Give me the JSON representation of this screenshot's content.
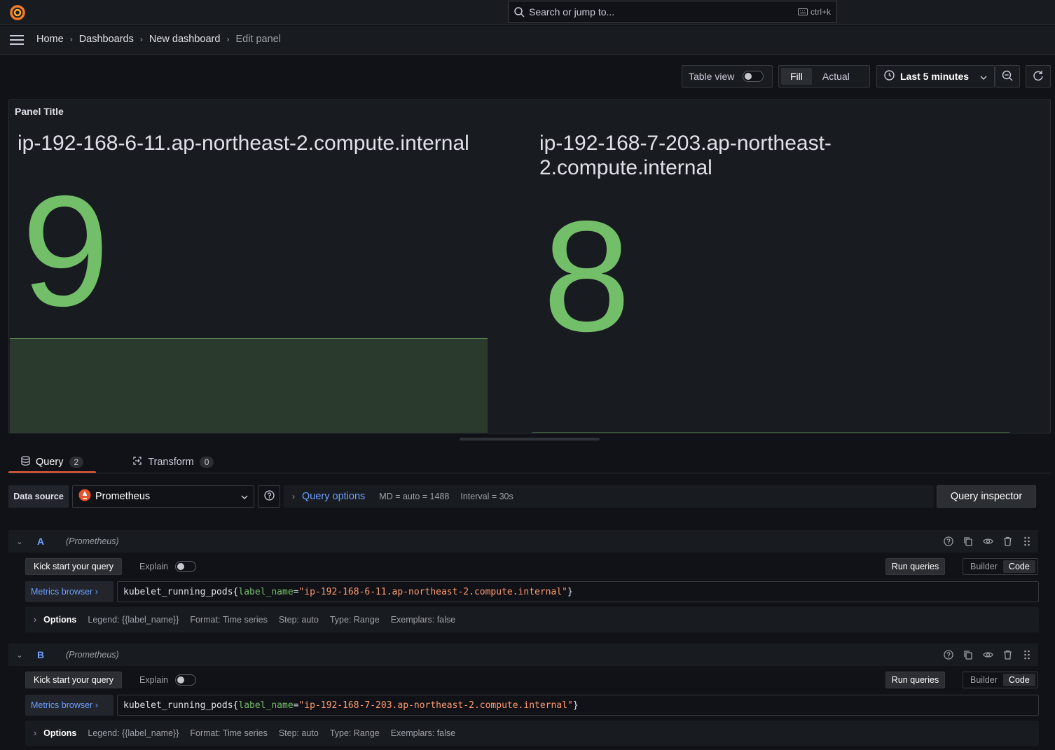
{
  "topbar": {
    "search_placeholder": "Search or jump to...",
    "shortcut": "ctrl+k"
  },
  "breadcrumb": [
    "Home",
    "Dashboards",
    "New dashboard",
    "Edit panel"
  ],
  "toolbar": {
    "table_view": "Table view",
    "fill": "Fill",
    "actual": "Actual",
    "time_range": "Last 5 minutes"
  },
  "panel": {
    "title": "Panel Title",
    "stats": [
      {
        "name": "ip-192-168-6-11.ap-northeast-2.compute.internal",
        "value": "9"
      },
      {
        "name_line1": "ip-192-168-7-203.ap-northeast-",
        "name_line2": "2.compute.internal",
        "value": "8"
      }
    ],
    "value_color": "#73bf69"
  },
  "tabs": [
    {
      "label": "Query",
      "count": "2"
    },
    {
      "label": "Transform",
      "count": "0"
    }
  ],
  "datasource": {
    "label": "Data source",
    "selected": "Prometheus",
    "query_options": "Query options",
    "md": "MD = auto = 1488",
    "interval": "Interval = 30s",
    "inspector": "Query inspector"
  },
  "queries": [
    {
      "ref": "A",
      "ds": "(Prometheus)",
      "kick": "Kick start your query",
      "explain": "Explain",
      "run": "Run queries",
      "builder": "Builder",
      "code": "Code",
      "metrics_browser": "Metrics browser",
      "q_metric": "kubelet_running_pods{",
      "q_label": "label_name",
      "q_eq": "=",
      "q_value": "\"ip-192-168-6-11.ap-northeast-2.compute.internal\"",
      "q_close": "}",
      "options": "Options",
      "legend": "Legend: {{label_name}}",
      "format": "Format: Time series",
      "step": "Step: auto",
      "type": "Type: Range",
      "exemplars": "Exemplars: false"
    },
    {
      "ref": "B",
      "ds": "(Prometheus)",
      "kick": "Kick start your query",
      "explain": "Explain",
      "run": "Run queries",
      "builder": "Builder",
      "code": "Code",
      "metrics_browser": "Metrics browser",
      "q_metric": "kubelet_running_pods{",
      "q_label": "label_name",
      "q_eq": "=",
      "q_value": "\"ip-192-168-7-203.ap-northeast-2.compute.internal\"",
      "q_close": "}",
      "options": "Options",
      "legend": "Legend: {{label_name}}",
      "format": "Format: Time series",
      "step": "Step: auto",
      "type": "Type: Range",
      "exemplars": "Exemplars: false"
    }
  ],
  "colors": {
    "accent": "#f55f3e",
    "link": "#6e9fff",
    "stat_green": "#73bf69"
  }
}
